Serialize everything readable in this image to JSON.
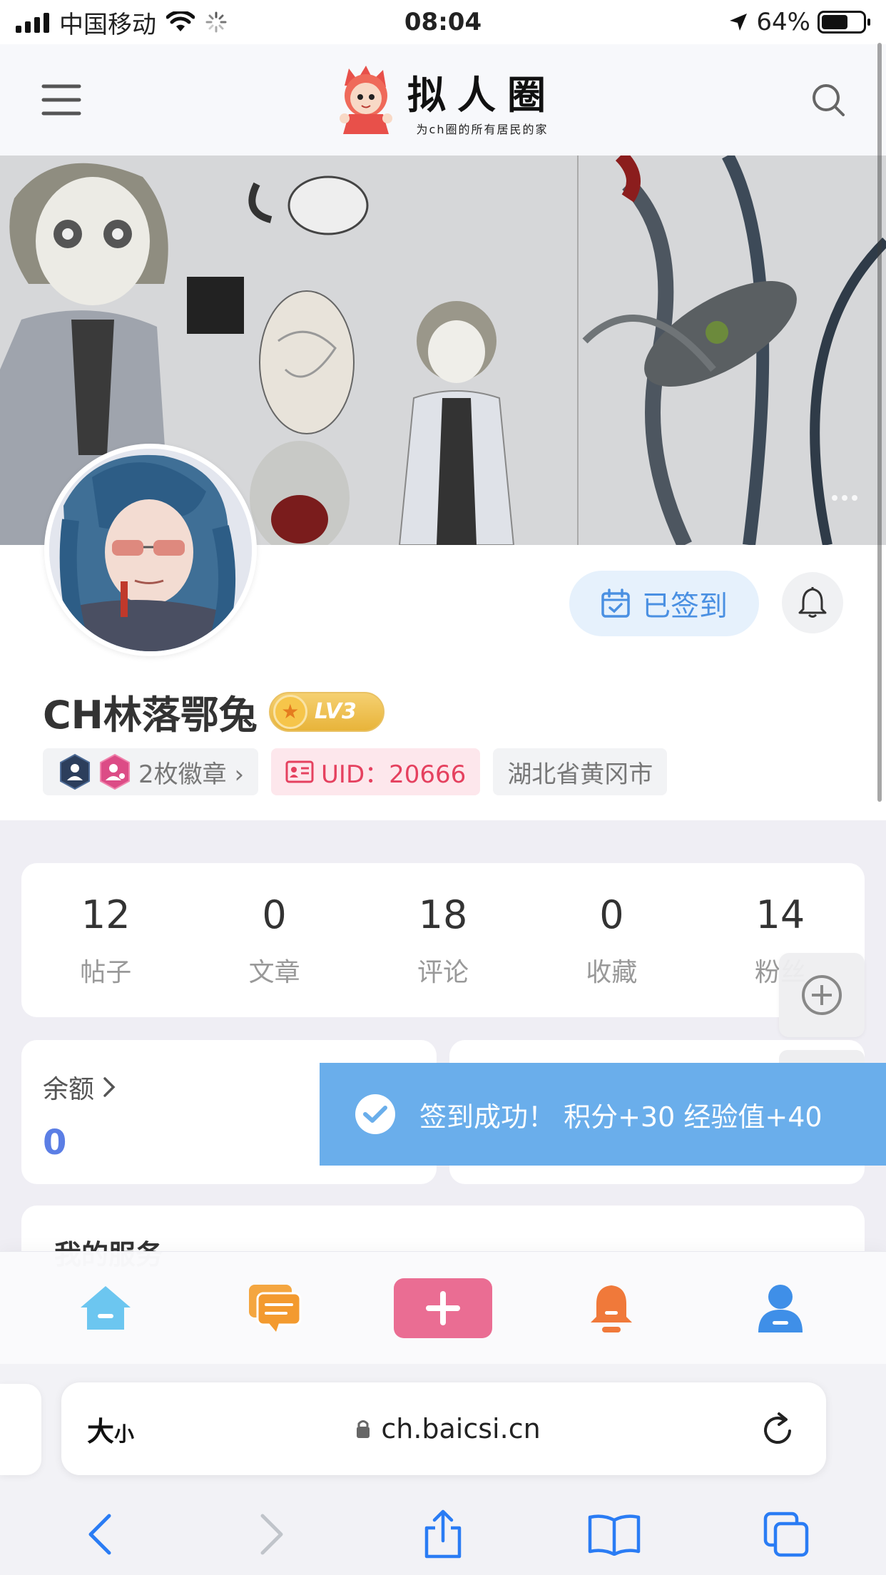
{
  "status_bar": {
    "carrier": "中国移动",
    "time": "08:04",
    "battery": "64%"
  },
  "header": {
    "logo_title": "拟人圈",
    "logo_subtitle": "为ch圈的所有居民的家"
  },
  "banner": {
    "slides_count": 3
  },
  "profile": {
    "checkin_label": "已签到",
    "username": "CH林落鄂兔",
    "level": "LV3",
    "badges_label": "2枚徽章 ›",
    "uid": "UID：20666",
    "location": "湖北省黄冈市"
  },
  "stats": [
    {
      "value": "12",
      "label": "帖子"
    },
    {
      "value": "0",
      "label": "文章"
    },
    {
      "value": "18",
      "label": "评论"
    },
    {
      "value": "0",
      "label": "收藏"
    },
    {
      "value": "14",
      "label": "粉丝"
    }
  ],
  "balance": {
    "label": "余额",
    "value": "0"
  },
  "toast": {
    "message": "签到成功！  积分+30 经验值+40"
  },
  "services": {
    "title": "我的服务"
  },
  "tabbar": {
    "items": [
      "home",
      "messages",
      "publish",
      "notifications",
      "profile"
    ]
  },
  "browser": {
    "aa_big": "大",
    "aa_small": "小",
    "url": "ch.baicsi.cn"
  },
  "colors": {
    "accent_blue": "#4a90e2",
    "uid_red": "#e5415f",
    "publish_pink": "#ea6d93",
    "toast_blue": "#6aaeeb",
    "balance_value": "#5b7ee5"
  }
}
